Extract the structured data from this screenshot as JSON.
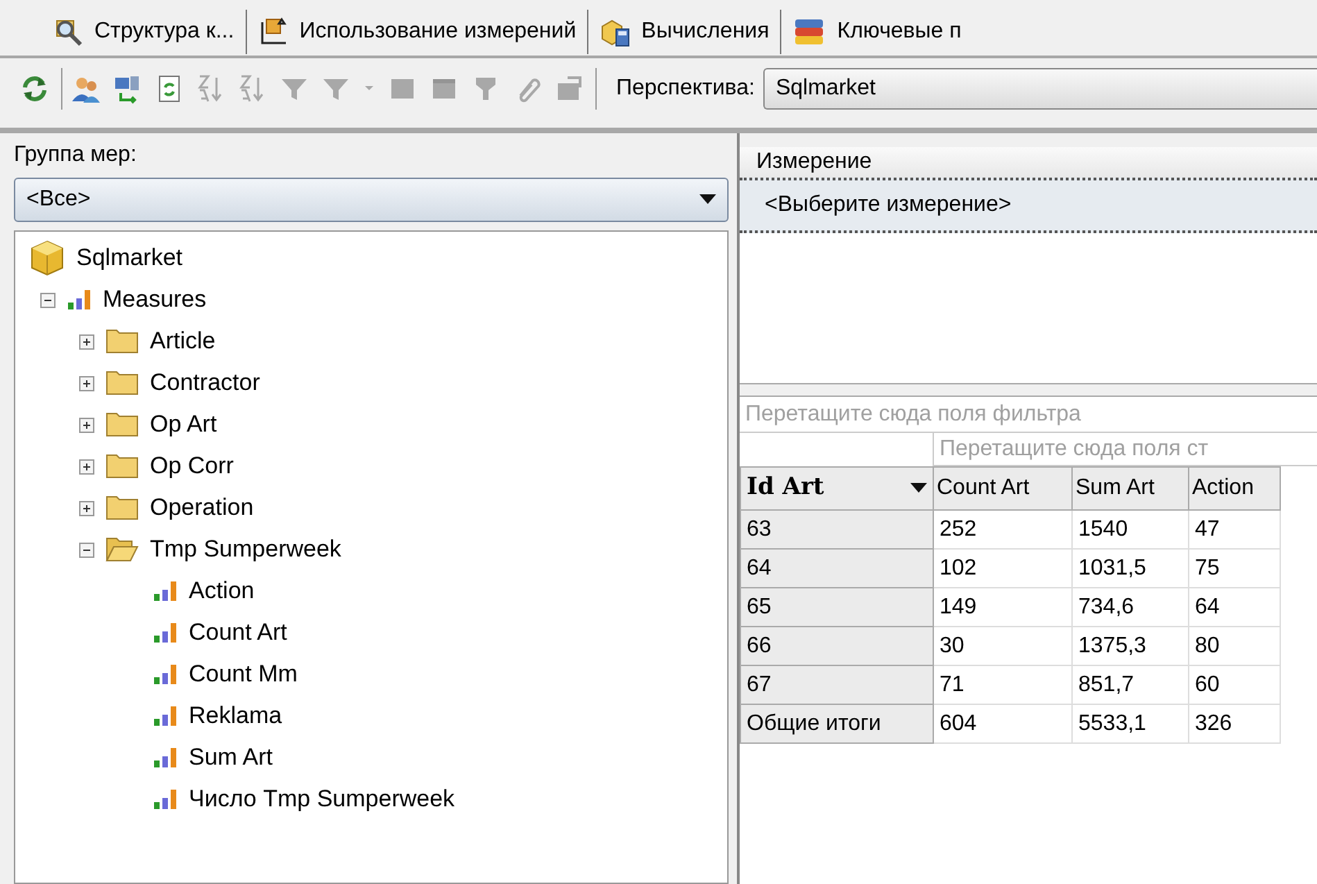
{
  "tabs": [
    {
      "label": "Структура к...",
      "kind": "structure"
    },
    {
      "label": "Использование измерений",
      "kind": "usage"
    },
    {
      "label": "Вычисления",
      "kind": "calc"
    },
    {
      "label": "Ключевые п",
      "kind": "kpi"
    }
  ],
  "toolbar": {
    "groups": [
      [
        {
          "kind": "refresh",
          "disabled": false
        }
      ],
      [
        {
          "kind": "users",
          "disabled": false
        },
        {
          "kind": "server",
          "disabled": false
        },
        {
          "kind": "doc-refresh",
          "disabled": false
        },
        {
          "kind": "sort-asc",
          "disabled": true
        },
        {
          "kind": "sort-desc",
          "disabled": true
        },
        {
          "kind": "filter",
          "disabled": true
        },
        {
          "kind": "filter-menu",
          "disabled": true
        },
        {
          "kind": "caret",
          "disabled": true
        },
        {
          "kind": "table",
          "disabled": true
        },
        {
          "kind": "table-edit",
          "disabled": true
        },
        {
          "kind": "funnel",
          "disabled": true
        },
        {
          "kind": "clip",
          "disabled": true
        },
        {
          "kind": "window",
          "disabled": true
        }
      ]
    ],
    "perspective": {
      "label": "Перспектива:",
      "value": "Sqlmarket"
    }
  },
  "measure_group": {
    "label": "Группа мер:",
    "value": "<Все>"
  },
  "tree": {
    "label": "Sqlmarket",
    "kind": "cube",
    "children": [
      {
        "label": "Measures",
        "kind": "measures",
        "expanded": true,
        "children": [
          {
            "label": "Article",
            "kind": "folder",
            "expanded": false
          },
          {
            "label": "Contractor",
            "kind": "folder",
            "expanded": false
          },
          {
            "label": "Op Art",
            "kind": "folder",
            "expanded": false
          },
          {
            "label": "Op Corr",
            "kind": "folder",
            "expanded": false
          },
          {
            "label": "Operation",
            "kind": "folder",
            "expanded": false
          },
          {
            "label": "Tmp Sumperweek",
            "kind": "folder",
            "expanded": true,
            "children": [
              {
                "label": "Action",
                "kind": "measure"
              },
              {
                "label": "Count Art",
                "kind": "measure"
              },
              {
                "label": "Count Mm",
                "kind": "measure"
              },
              {
                "label": "Reklama",
                "kind": "measure"
              },
              {
                "label": "Sum Art",
                "kind": "measure"
              },
              {
                "label": "Число Tmp Sumperweek",
                "kind": "measure"
              }
            ]
          }
        ]
      }
    ]
  },
  "dimension": {
    "header": "Измерение",
    "placeholder": "<Выберите измерение>"
  },
  "pivot": {
    "filter_hint": "Перетащите сюда поля фильтра",
    "column_hint": "Перетащите сюда поля ст",
    "row_field": "Id Art",
    "columns": [
      "Count Art",
      "Sum Art",
      "Action"
    ],
    "rows": [
      {
        "label": "63",
        "cells": [
          "252",
          "1540",
          "47"
        ]
      },
      {
        "label": "64",
        "cells": [
          "102",
          "1031,5",
          "75"
        ]
      },
      {
        "label": "65",
        "cells": [
          "149",
          "734,6",
          "64"
        ]
      },
      {
        "label": "66",
        "cells": [
          "30",
          "1375,3",
          "80"
        ]
      },
      {
        "label": "67",
        "cells": [
          "71",
          "851,7",
          "60"
        ]
      },
      {
        "label": "Общие итоги",
        "cells": [
          "604",
          "5533,1",
          "326"
        ]
      }
    ]
  }
}
